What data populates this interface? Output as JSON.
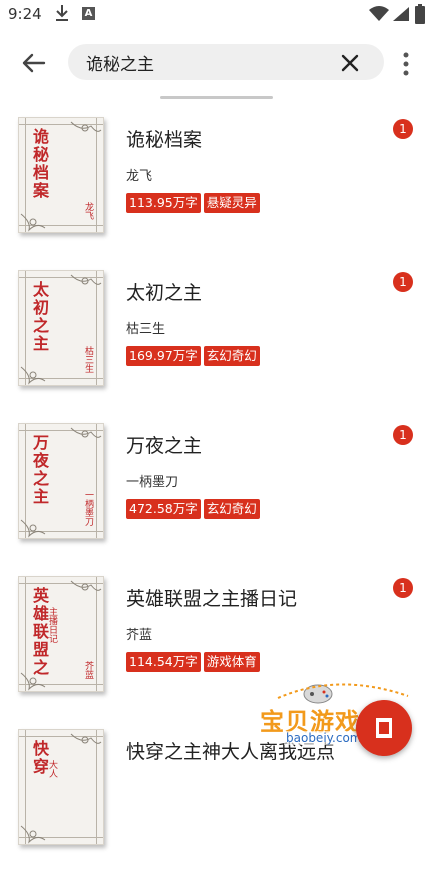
{
  "status_bar": {
    "time": "9:24",
    "icon_a": "A"
  },
  "search": {
    "value": "诡秘之主"
  },
  "books": [
    {
      "title": "诡秘档案",
      "author": "龙飞",
      "words": "113.95万字",
      "genre": "悬疑灵异",
      "badge": "1",
      "cover_title": "诡秘档案",
      "cover_author": "龙飞"
    },
    {
      "title": "太初之主",
      "author": "枯三生",
      "words": "169.97万字",
      "genre": "玄幻奇幻",
      "badge": "1",
      "cover_title": "太初之主",
      "cover_author": "枯三生"
    },
    {
      "title": "万夜之主",
      "author": "一柄墨刀",
      "words": "472.58万字",
      "genre": "玄幻奇幻",
      "badge": "1",
      "cover_title": "万夜之主",
      "cover_author": "一柄墨刀"
    },
    {
      "title": "英雄联盟之主播日记",
      "author": "芥蓝",
      "words": "114.54万字",
      "genre": "游戏体育",
      "badge": "1",
      "cover_title": "英雄联盟之",
      "cover_sub": "主播日记",
      "cover_author": "芥蓝"
    },
    {
      "title": "快穿之主神大人离我远点",
      "author": "",
      "words": "",
      "genre": "",
      "badge": "",
      "cover_title": "快穿",
      "cover_sub": "大人"
    }
  ],
  "watermark": {
    "text": "宝贝游戏网",
    "url": "baobeiy.com"
  },
  "icons": {
    "back": "arrow-left-icon",
    "clear": "close-icon",
    "more": "more-vert-icon",
    "download": "download-icon",
    "wifi": "wifi-icon",
    "signal": "signal-icon",
    "battery": "battery-icon"
  },
  "colors": {
    "accent": "#d8301d",
    "cover_text": "#c0282a",
    "search_bg": "#efefef"
  }
}
